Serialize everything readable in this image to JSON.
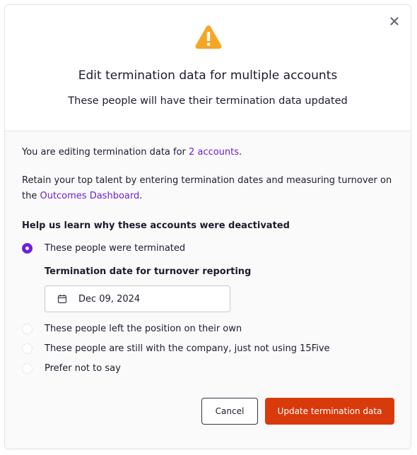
{
  "dialog": {
    "icon": "warning-triangle-icon",
    "title": "Edit termination data for multiple accounts",
    "subtitle": "These people will have their termination data updated",
    "close_icon": "close-icon"
  },
  "body": {
    "editing_prefix": "You are editing termination data for ",
    "editing_link": "2 accounts",
    "editing_suffix": ".",
    "retain_text": "Retain your top talent by entering termination dates and measuring turnover on the ",
    "retain_link": "Outcomes Dashboard",
    "retain_suffix": ".",
    "question": "Help us learn why these accounts were deactivated",
    "options": [
      {
        "label": "These people were terminated",
        "selected": true
      },
      {
        "label": "These people left the position on their own",
        "selected": false
      },
      {
        "label": "These people are still with the company, just not using 15Five",
        "selected": false
      },
      {
        "label": "Prefer not to say",
        "selected": false
      }
    ],
    "date_label": "Termination date for turnover reporting",
    "date_value": "Dec 09, 2024",
    "date_icon": "calendar-icon"
  },
  "footer": {
    "cancel_label": "Cancel",
    "submit_label": "Update termination data"
  },
  "colors": {
    "accent": "#6f1fe0",
    "link": "#6b21d8",
    "primary_button": "#d93a0c",
    "warning": "#f5a623"
  }
}
